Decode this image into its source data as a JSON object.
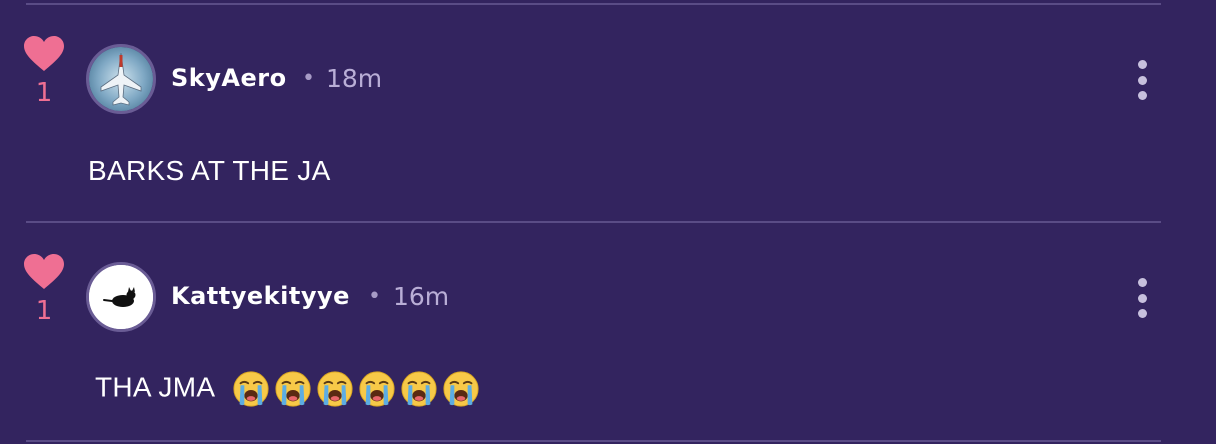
{
  "comments": [
    {
      "username": "SkyAero",
      "time": "18m",
      "likes": "1",
      "text": "BARKS AT THE JA",
      "avatar_icon": "fighter-jet-icon",
      "emoji_count": 0
    },
    {
      "username": "Kattyekityye",
      "time": "16m",
      "likes": "1",
      "text": "THA JMA",
      "avatar_icon": "black-cat-icon",
      "emoji_count": 6,
      "emoji_icon": "loudly-crying-face-icon"
    }
  ],
  "separator": "•",
  "colors": {
    "background": "#33245f",
    "heart": "#ef6f93",
    "divider": "#5a4c86",
    "timestamp": "#b9aed6"
  }
}
